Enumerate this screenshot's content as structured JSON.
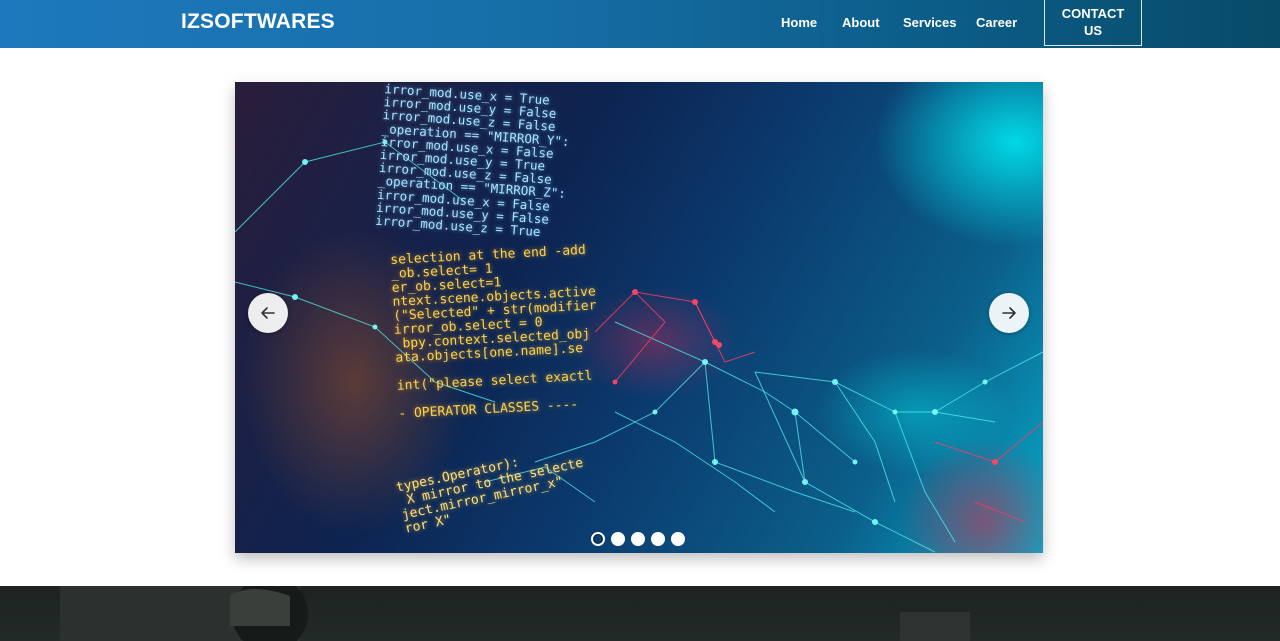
{
  "nav": {
    "brand": "IZSOFTWARES",
    "links": [
      "Home",
      "About",
      "Services",
      "Career"
    ],
    "contact": "CONTACT US"
  },
  "carousel": {
    "code_blue": "irror_mod.use_x = True\nirror_mod.use_y = False\nirror_mod.use_z = False\n_operation == \"MIRROR_Y\":\nirror_mod.use_x = False\nirror_mod.use_y = True\nirror_mod.use_z = False\n_operation == \"MIRROR_Z\":\nirror_mod.use_x = False\nirror_mod.use_y = False\nirror_mod.use_z = True",
    "code_yellow": "selection at the end -add\n_ob.select= 1\ner_ob.select=1\nntext.scene.objects.active\n(\"Selected\" + str(modifier\nirror_ob.select = 0\n bpy.context.selected_obj\nata.objects[one.name].se\n\nint(\"please select exactl\n\n- OPERATOR CLASSES ----",
    "code_bottom": "types.Operator):\n X mirror to the selecte\nject.mirror_mirror_x\"\nror X\"",
    "slide_count": 5,
    "active_slide": 1
  },
  "icons": {
    "prev": "arrow-left-icon",
    "next": "arrow-right-icon"
  }
}
